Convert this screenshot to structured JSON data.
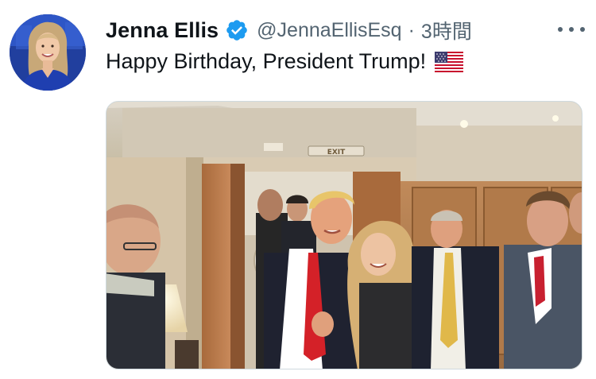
{
  "tweet": {
    "author_name": "Jenna Ellis",
    "handle": "@JennaEllisEsq",
    "separator": "·",
    "timestamp": "3時間",
    "text": "Happy Birthday, President Trump!",
    "flag_icon": "us-flag-icon",
    "verified_icon": "verified-badge-icon",
    "more_icon": "more-options-icon",
    "exit_sign": "EXIT"
  },
  "colors": {
    "verified_blue": "#1d9bf0",
    "secondary_text": "#536471",
    "primary_text": "#0f1419"
  }
}
